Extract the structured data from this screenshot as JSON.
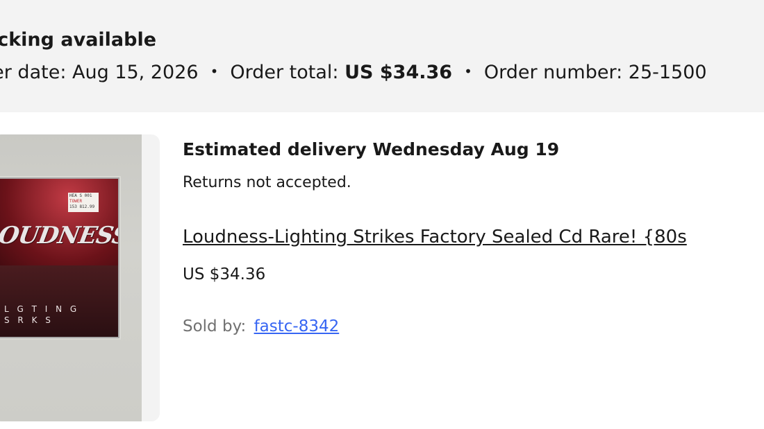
{
  "header": {
    "title": "acking available",
    "order_date_label": "der date:",
    "order_date": "Aug 15, 2026",
    "order_total_label": "Order total:",
    "order_total": "US $34.36",
    "order_number_label": "Order number:",
    "order_number": "25-1500",
    "separator": "•"
  },
  "item": {
    "delivery": "Estimated delivery Wednesday Aug 19",
    "returns": "Returns not accepted.",
    "title": "Loudness-Lighting Strikes Factory Sealed Cd Rare! {80s",
    "price": "US $34.36",
    "sold_by_label": "Sold by:",
    "seller": "fastc-8342"
  },
  "image": {
    "logo_text": "OUDNESS",
    "subtitle_line1": "L G T I N G",
    "subtitle_line2": "S R K S",
    "sticker_line1": "HEA S 001",
    "sticker_line2": "TOWER",
    "sticker_line3": "153 812.99"
  },
  "colors": {
    "header_bg": "#f3f3f3",
    "link": "#3665f3",
    "muted": "#707070",
    "text": "#191919"
  }
}
